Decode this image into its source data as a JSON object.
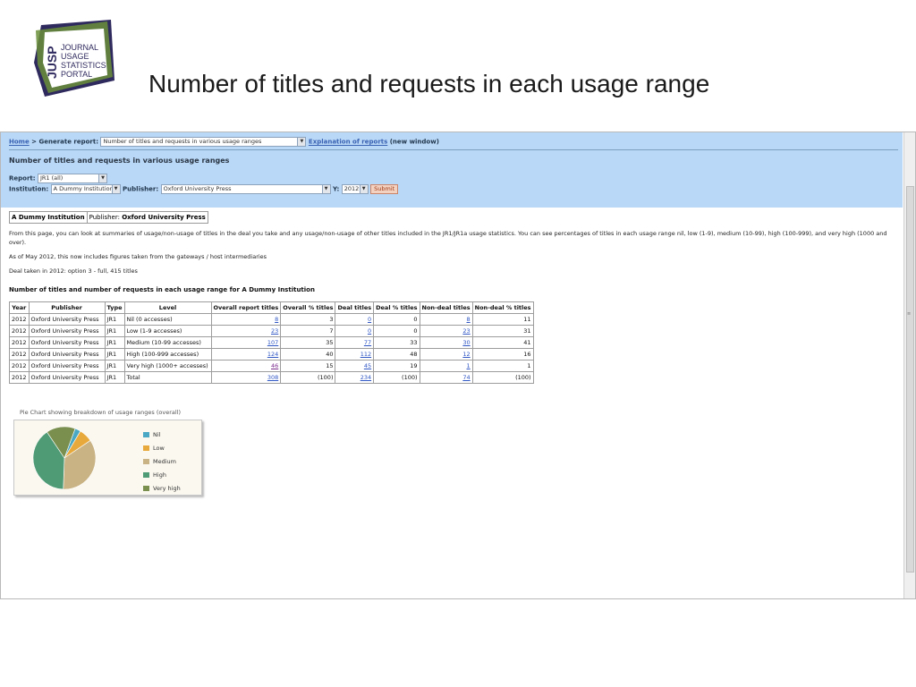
{
  "slide": {
    "title": "Number of titles and requests in each usage range",
    "logo": {
      "letters": "JUSP",
      "line1": "JOURNAL",
      "line2": "USAGE",
      "line3": "STATISTICS",
      "line4": "PORTAL"
    }
  },
  "breadcrumb": {
    "home": "Home",
    "sep": ">",
    "generate": "Generate report:",
    "report_select": "Number of titles and requests in various usage ranges",
    "explain_link": "Explanation of reports",
    "new_window": "(new window)"
  },
  "page_heading": "Number of titles and requests in various usage ranges",
  "filters": {
    "report_label": "Report:",
    "report_value": "JR1 (all)",
    "institution_label": "Institution:",
    "institution_value": "A Dummy Institution",
    "publisher_label": "Publisher:",
    "publisher_value": "Oxford University Press",
    "year_label": "Y:",
    "year_value": "2012",
    "submit": "Submit"
  },
  "context": {
    "institution": "A Dummy Institution",
    "publisher_label": "Publisher:",
    "publisher": "Oxford University Press"
  },
  "intro": {
    "p1": "From this page, you can look at summaries of usage/non-usage of titles in the deal you take and any usage/non-usage of other titles included in the JR1/JR1a usage statistics. You can see percentages of titles in each usage range nil, low (1-9), medium (10-99), high (100-999), and very high (1000 and over).",
    "p2": "As of May 2012, this now includes figures taken from the gateways / host intermediaries",
    "p3": "Deal taken in 2012: option 3 - full, 415 titles"
  },
  "table": {
    "caption": "Number of titles and number of requests in each usage range for A Dummy Institution",
    "headers": [
      "Year",
      "Publisher",
      "Type",
      "Level",
      "Overall report titles",
      "Overall % titles",
      "Deal titles",
      "Deal % titles",
      "Non-deal titles",
      "Non-deal % titles"
    ],
    "rows": [
      [
        "2012",
        "Oxford University Press",
        "JR1",
        "Nil (0 accesses)",
        "8",
        "3",
        "0",
        "0",
        "8",
        "11"
      ],
      [
        "2012",
        "Oxford University Press",
        "JR1",
        "Low (1-9 accesses)",
        "23",
        "7",
        "0",
        "0",
        "23",
        "31"
      ],
      [
        "2012",
        "Oxford University Press",
        "JR1",
        "Medium (10-99 accesses)",
        "107",
        "35",
        "77",
        "33",
        "30",
        "41"
      ],
      [
        "2012",
        "Oxford University Press",
        "JR1",
        "High (100-999 accesses)",
        "124",
        "40",
        "112",
        "48",
        "12",
        "16"
      ],
      [
        "2012",
        "Oxford University Press",
        "JR1",
        "Very high (1000+ accesses)",
        "46",
        "15",
        "45",
        "19",
        "1",
        "1"
      ],
      [
        "2012",
        "Oxford University Press",
        "JR1",
        "Total",
        "308",
        "(100)",
        "234",
        "(100)",
        "74",
        "(100)"
      ]
    ]
  },
  "chart_caption": "Pie Chart showing breakdown of usage ranges (overall)",
  "chart_data": {
    "type": "pie",
    "categories": [
      "Nil",
      "Low",
      "Medium",
      "High",
      "Very high"
    ],
    "values": [
      3,
      7,
      35,
      40,
      15
    ],
    "colors": [
      "#4aa8c4",
      "#e8a93c",
      "#c9b384",
      "#4f9b76",
      "#7a8f4e"
    ],
    "legend": "right"
  }
}
